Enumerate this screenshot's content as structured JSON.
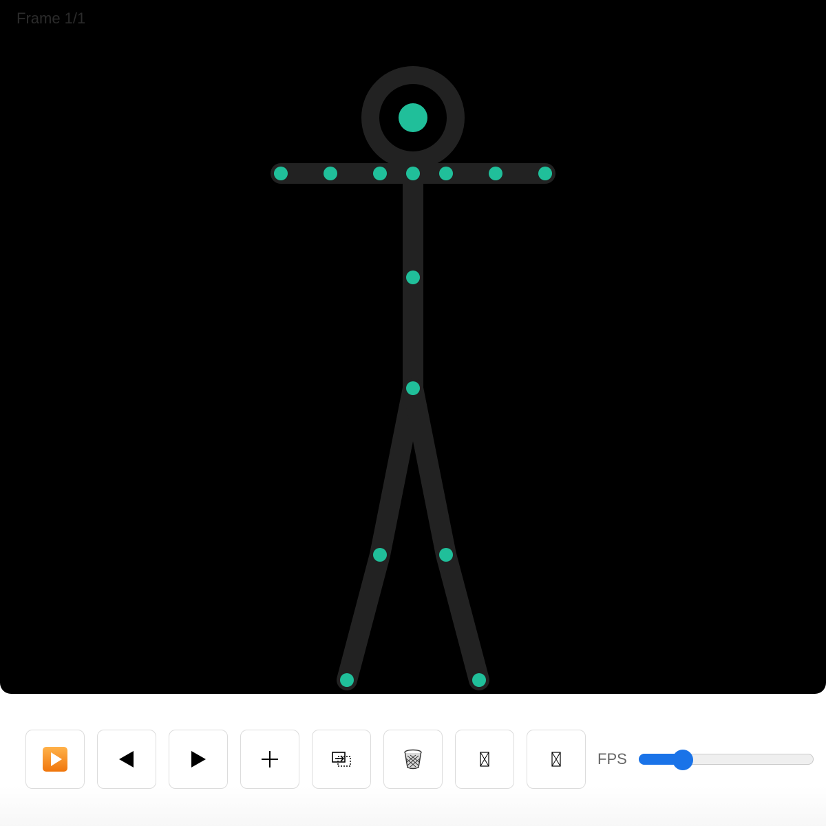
{
  "canvas": {
    "frame_label": "Frame 1/1",
    "background_color": "#000000",
    "limb_color": "#222222",
    "joint_color": "#20bf9a"
  },
  "toolbar": {
    "buttons": [
      {
        "name": "play-button",
        "icon": "play-icon"
      },
      {
        "name": "prev-frame-button",
        "icon": "triangle-left-icon"
      },
      {
        "name": "next-frame-button",
        "icon": "triangle-right-icon"
      },
      {
        "name": "add-frame-button",
        "icon": "plus-icon"
      },
      {
        "name": "duplicate-frame-button",
        "icon": "copy-frame-icon"
      },
      {
        "name": "delete-frame-button",
        "icon": "wastebasket-icon"
      },
      {
        "name": "tool-button-7",
        "icon": "missing-glyph-icon"
      },
      {
        "name": "tool-button-8",
        "icon": "missing-glyph-icon"
      }
    ],
    "fps": {
      "label": "FPS",
      "value_fraction": 0.22,
      "accent_color": "#1a73e8"
    }
  }
}
